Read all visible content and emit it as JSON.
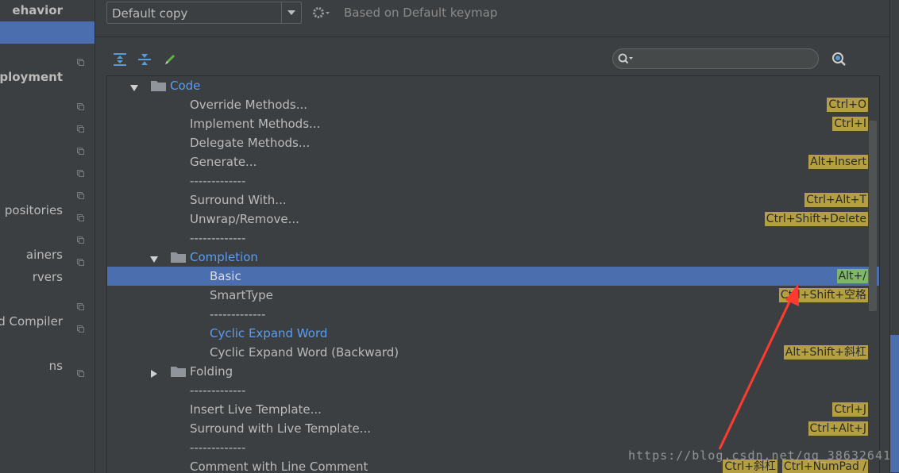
{
  "sidebar": {
    "items": [
      {
        "label": "ehavior",
        "bold": true,
        "copy": false,
        "selected": false
      },
      {
        "label": "",
        "bold": false,
        "copy": false,
        "selected": true
      },
      {
        "label": "",
        "bold": false,
        "copy": true,
        "selected": false
      },
      {
        "label": "Deployment",
        "bold": true,
        "copy": false,
        "selected": false
      },
      {
        "label": "",
        "bold": false,
        "copy": true,
        "selected": false
      },
      {
        "label": "",
        "bold": false,
        "copy": true,
        "selected": false
      },
      {
        "label": "",
        "bold": false,
        "copy": true,
        "selected": false
      },
      {
        "label": "",
        "bold": false,
        "copy": true,
        "selected": false
      },
      {
        "label": "",
        "bold": false,
        "copy": true,
        "selected": false
      },
      {
        "label": "positories",
        "bold": false,
        "copy": true,
        "selected": false
      },
      {
        "label": "",
        "bold": false,
        "copy": true,
        "selected": false
      },
      {
        "label": "ainers",
        "bold": false,
        "copy": true,
        "selected": false
      },
      {
        "label": "rvers",
        "bold": false,
        "copy": false,
        "selected": false
      },
      {
        "label": "",
        "bold": false,
        "copy": true,
        "selected": false
      },
      {
        "label": "d Compiler",
        "bold": false,
        "copy": true,
        "selected": false
      },
      {
        "label": "",
        "bold": false,
        "copy": false,
        "selected": false
      },
      {
        "label": "ns",
        "bold": false,
        "copy": true,
        "selected": false
      }
    ]
  },
  "keymap": {
    "selected": "Default copy",
    "based_on": "Based on Default keymap"
  },
  "search": {
    "placeholder": ""
  },
  "colors": {
    "accent": "#4b6eaf",
    "shortcut_bg": "#b4a043",
    "selected_shortcut_bg": "#7eb76a",
    "folder": "#8f959a",
    "annotation_arrow": "#ff3b30"
  },
  "tree": [
    {
      "label": "Code",
      "level": 0,
      "folder": true,
      "expanded": true,
      "blue": true,
      "shortcuts": []
    },
    {
      "label": "Override Methods...",
      "level": 1,
      "shortcuts": [
        "Ctrl+O"
      ]
    },
    {
      "label": "Implement Methods...",
      "level": 1,
      "shortcuts": [
        "Ctrl+I"
      ]
    },
    {
      "label": "Delegate Methods...",
      "level": 1,
      "shortcuts": []
    },
    {
      "label": "Generate...",
      "level": 1,
      "shortcuts": [
        "Alt+Insert"
      ]
    },
    {
      "label": "-------------",
      "level": 1,
      "shortcuts": []
    },
    {
      "label": "Surround With...",
      "level": 1,
      "shortcuts": [
        "Ctrl+Alt+T"
      ]
    },
    {
      "label": "Unwrap/Remove...",
      "level": 1,
      "shortcuts": [
        "Ctrl+Shift+Delete"
      ]
    },
    {
      "label": "-------------",
      "level": 1,
      "shortcuts": []
    },
    {
      "label": "Completion",
      "level": 1,
      "folder": true,
      "expanded": true,
      "blue": true,
      "shortcuts": []
    },
    {
      "label": "Basic",
      "level": 2,
      "selected": true,
      "shortcuts": [
        "Alt+/"
      ]
    },
    {
      "label": "SmartType",
      "level": 2,
      "shortcuts": [
        "Ctrl+Shift+空格"
      ]
    },
    {
      "label": "-------------",
      "level": 2,
      "shortcuts": []
    },
    {
      "label": "Cyclic Expand Word",
      "level": 2,
      "blue": true,
      "shortcuts": []
    },
    {
      "label": "Cyclic Expand Word (Backward)",
      "level": 2,
      "shortcuts": [
        "Alt+Shift+斜杠"
      ]
    },
    {
      "label": "Folding",
      "level": 1,
      "folder": true,
      "expanded": false,
      "shortcuts": []
    },
    {
      "label": "-------------",
      "level": 1,
      "shortcuts": []
    },
    {
      "label": "Insert Live Template...",
      "level": 1,
      "shortcuts": [
        "Ctrl+J"
      ]
    },
    {
      "label": "Surround with Live Template...",
      "level": 1,
      "shortcuts": [
        "Ctrl+Alt+J"
      ]
    },
    {
      "label": "-------------",
      "level": 1,
      "shortcuts": []
    },
    {
      "label": "Comment with Line Comment",
      "level": 1,
      "shortcuts": [
        "Ctrl+斜杠",
        "Ctrl+NumPad /"
      ]
    }
  ],
  "watermark": "https://blog.csdn.net/qq_38632641"
}
